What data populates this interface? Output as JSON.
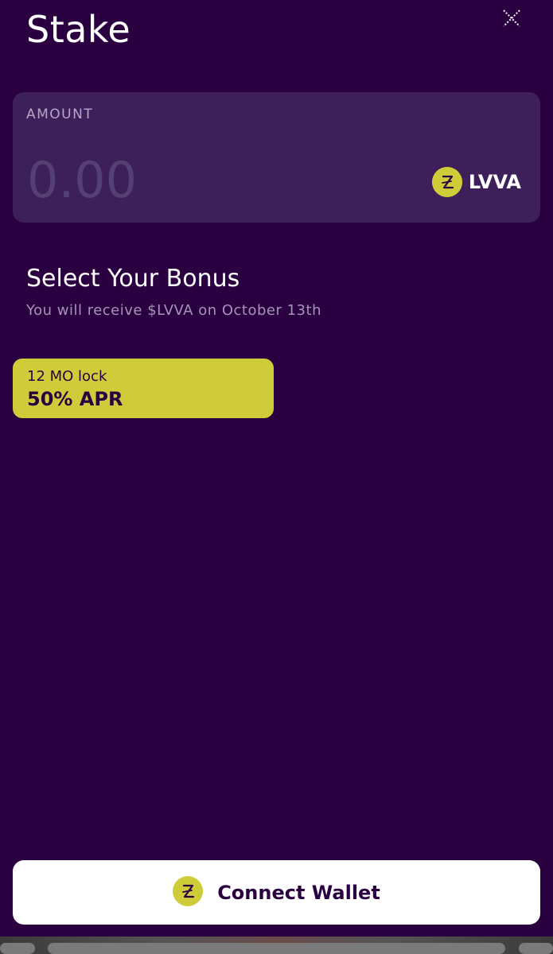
{
  "header": {
    "title": "Stake",
    "close_icon": "close-icon"
  },
  "amount": {
    "label": "AMOUNT",
    "placeholder": "0.00",
    "token": "LVVA",
    "token_icon": "lvva-coin-icon"
  },
  "bonus": {
    "title": "Select Your Bonus",
    "subtitle": "You will receive $LVVA on October 13th",
    "options": [
      {
        "lock": "12 MO lock",
        "apr": "50% APR",
        "selected": true
      }
    ]
  },
  "footer": {
    "connect_label": "Connect Wallet",
    "connect_icon": "lvva-coin-icon"
  },
  "colors": {
    "background": "#2a0040",
    "card": "#3d1f5a",
    "accent": "#cfcc3a",
    "muted_text": "#a693b8"
  }
}
